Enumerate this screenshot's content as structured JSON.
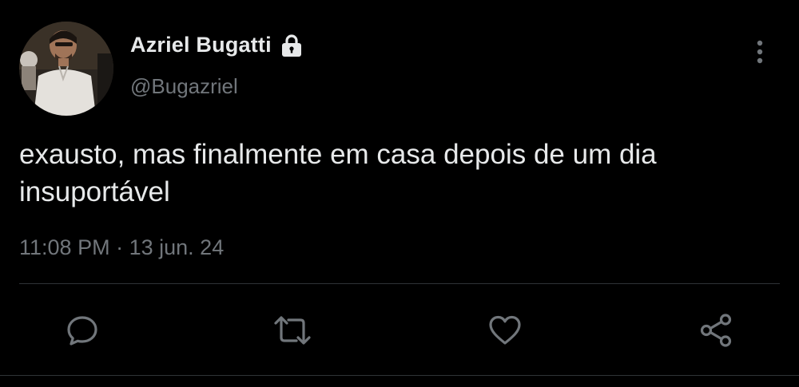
{
  "tweet": {
    "author": {
      "display_name": "Azriel Bugatti",
      "handle": "@Bugazriel",
      "protected_icon": "lock-icon",
      "avatar_icon": "avatar"
    },
    "text": "exausto, mas finalmente em casa depois de um dia insuportável",
    "time": "11:08 PM",
    "separator": "·",
    "date": "13 jun. 24",
    "more_icon": "more-vertical-icon"
  },
  "actions": [
    {
      "name": "reply",
      "icon": "reply-icon"
    },
    {
      "name": "retweet",
      "icon": "retweet-icon"
    },
    {
      "name": "like",
      "icon": "heart-icon"
    },
    {
      "name": "share",
      "icon": "share-icon"
    }
  ],
  "colors": {
    "background": "#000000",
    "primary_text": "#e7e9ea",
    "secondary_text": "#71767b",
    "divider": "#2f3336"
  }
}
